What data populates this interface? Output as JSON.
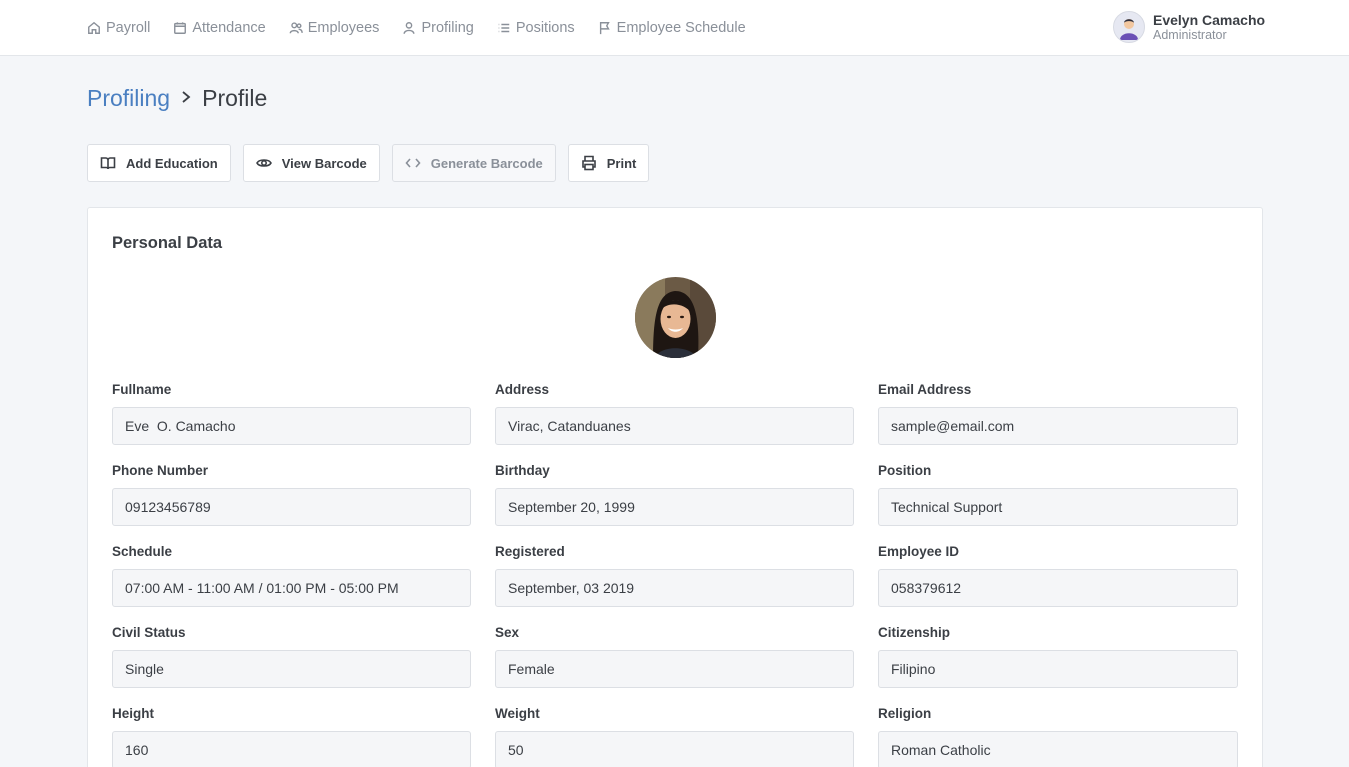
{
  "nav": {
    "items": [
      {
        "label": "Payroll",
        "icon": "home-icon"
      },
      {
        "label": "Attendance",
        "icon": "calendar-icon"
      },
      {
        "label": "Employees",
        "icon": "users-icon"
      },
      {
        "label": "Profiling",
        "icon": "user-icon"
      },
      {
        "label": "Positions",
        "icon": "list-icon"
      },
      {
        "label": "Employee Schedule",
        "icon": "flag-icon"
      }
    ]
  },
  "user": {
    "name": "Evelyn Camacho",
    "role": "Administrator"
  },
  "breadcrumb": {
    "parent": "Profiling",
    "current": "Profile"
  },
  "actions": {
    "add_education": "Add Education",
    "view_barcode": "View Barcode",
    "generate_barcode": "Generate Barcode",
    "print": "Print"
  },
  "card": {
    "title": "Personal Data"
  },
  "fields": [
    {
      "label": "Fullname",
      "value": "Eve  O. Camacho"
    },
    {
      "label": "Address",
      "value": "Virac, Catanduanes"
    },
    {
      "label": "Email Address",
      "value": "sample@email.com"
    },
    {
      "label": "Phone Number",
      "value": "09123456789"
    },
    {
      "label": "Birthday",
      "value": "September 20, 1999"
    },
    {
      "label": "Position",
      "value": "Technical Support"
    },
    {
      "label": "Schedule",
      "value": "07:00 AM - 11:00 AM / 01:00 PM - 05:00 PM"
    },
    {
      "label": "Registered",
      "value": "September, 03 2019"
    },
    {
      "label": "Employee ID",
      "value": "058379612"
    },
    {
      "label": "Civil Status",
      "value": "Single"
    },
    {
      "label": "Sex",
      "value": "Female"
    },
    {
      "label": "Citizenship",
      "value": "Filipino"
    },
    {
      "label": "Height",
      "value": "160"
    },
    {
      "label": "Weight",
      "value": "50"
    },
    {
      "label": "Religion",
      "value": "Roman Catholic"
    }
  ],
  "colors": {
    "link": "#4a7fc1",
    "background": "#f4f6f9",
    "input_bg": "#f5f6f8"
  }
}
